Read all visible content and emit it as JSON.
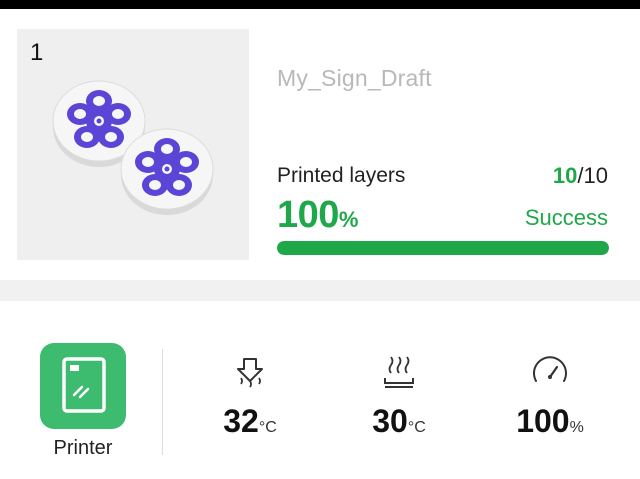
{
  "job": {
    "index": "1",
    "name": "My_Sign_Draft",
    "layers_label": "Printed layers",
    "layers_current": "10",
    "layers_total": "/10",
    "progress_value": "100",
    "progress_unit": "%",
    "progress_fraction": 1.0,
    "status": "Success",
    "accent_color": "#1fa84a",
    "thumbnail_icon": "flower-coaster-model"
  },
  "panel": {
    "printer_label": "Printer",
    "printer_icon": "printer-icon",
    "nozzle_temp": {
      "value": "32",
      "unit": "°C",
      "icon": "nozzle-temp-icon"
    },
    "bed_temp": {
      "value": "30",
      "unit": "°C",
      "icon": "heatbed-icon"
    },
    "speed": {
      "value": "100",
      "unit": "%",
      "icon": "speed-gauge-icon"
    },
    "button_color": "#3dbb6f"
  }
}
